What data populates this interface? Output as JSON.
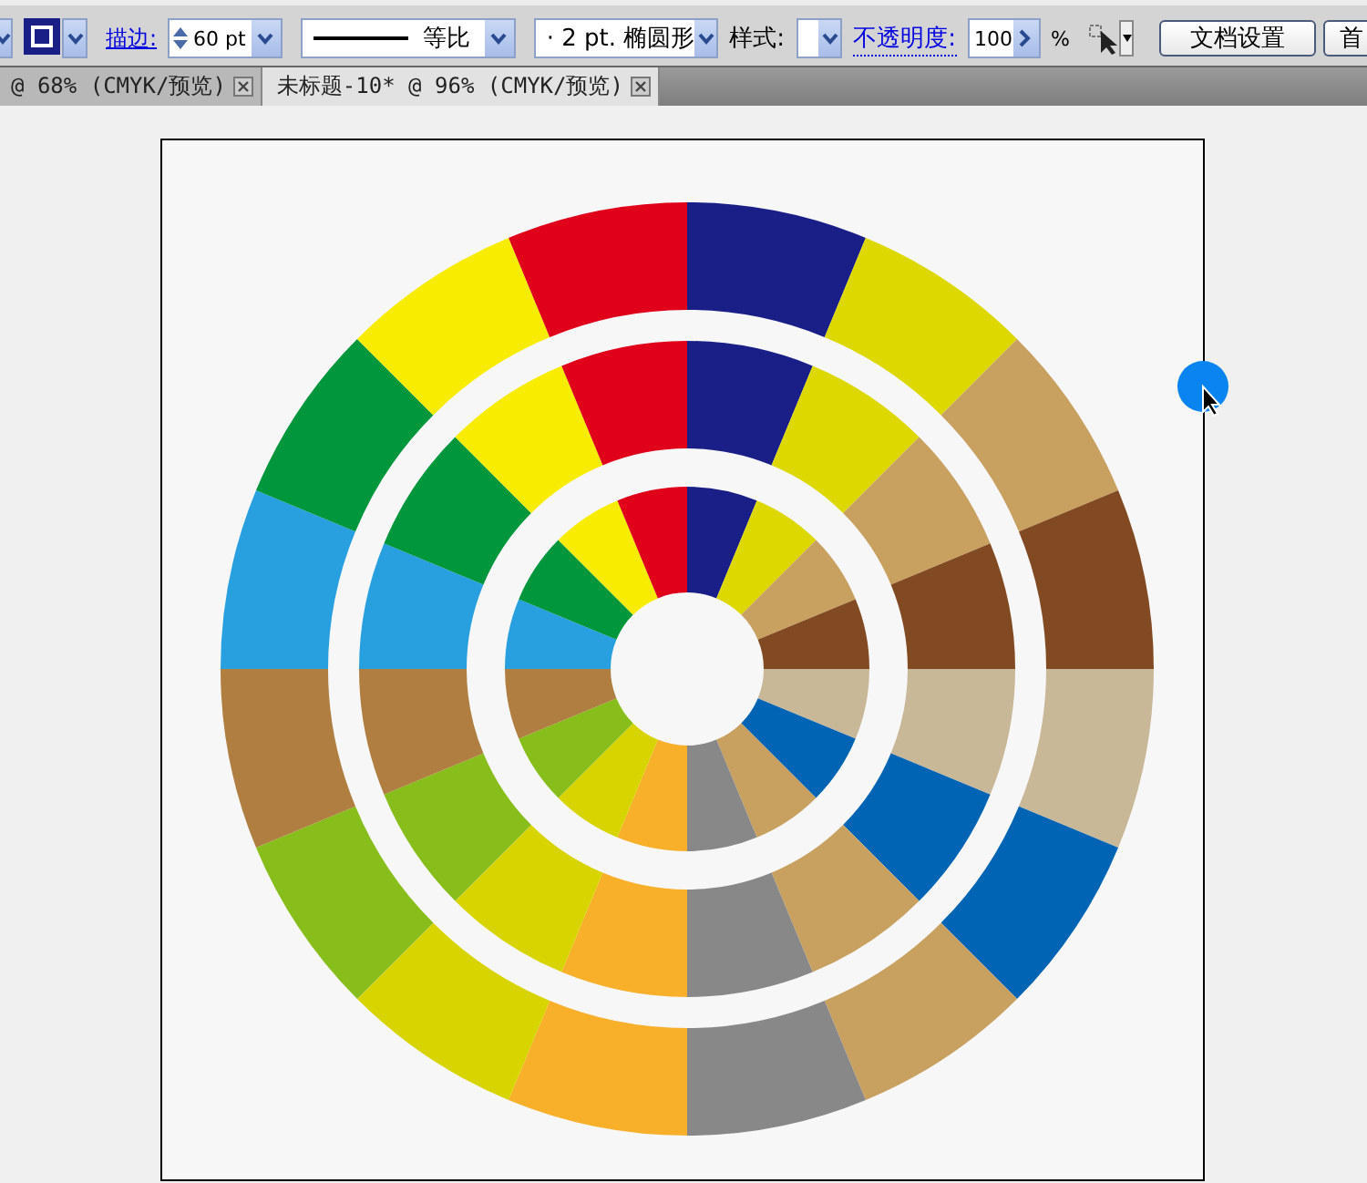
{
  "control_bar": {
    "stroke_label": "描边:",
    "stroke_weight": "60 pt",
    "profile": "等比",
    "brush": "·  2 pt. 椭圆形",
    "style_label": "样式:",
    "opacity_label": "不透明度:",
    "opacity": "100",
    "opacity_unit": "%",
    "buttons": [
      "文档设置",
      "首"
    ]
  },
  "tabs": [
    {
      "label": "@ 68% (CMYK/预览)",
      "selected": false
    },
    {
      "label": "未标题-10* @ 96% (CMYK/预览)",
      "selected": true
    }
  ],
  "color_wheel": {
    "segments": [
      {
        "color": "#1a1f88"
      },
      {
        "color": "#dcd800"
      },
      {
        "color": "#c8a060"
      },
      {
        "color": "#824a22"
      },
      {
        "color": "#c9b898"
      },
      {
        "color": "#0064b4"
      },
      {
        "color": "#c8a060"
      },
      {
        "color": "#888888"
      },
      {
        "color": "#f8b02a"
      },
      {
        "color": "#d8d400"
      },
      {
        "color": "#88be1c"
      },
      {
        "color": "#b07e40"
      },
      {
        "color": "#28a0e0"
      },
      {
        "color": "#00963c"
      },
      {
        "color": "#f8ec00"
      },
      {
        "color": "#e0001a"
      }
    ]
  }
}
